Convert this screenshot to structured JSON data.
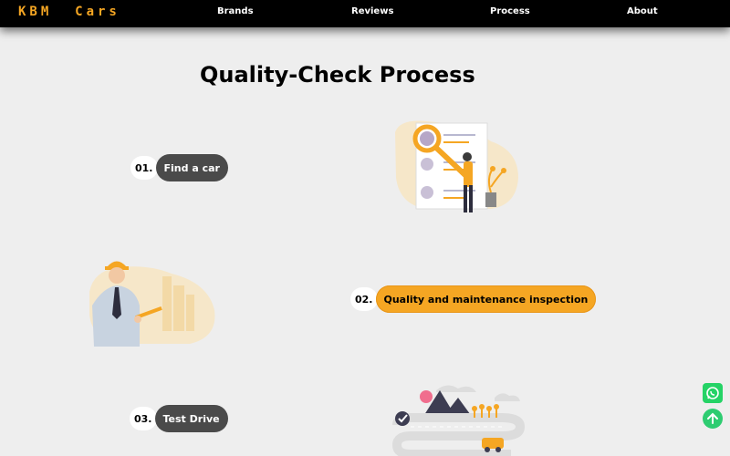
{
  "nav": {
    "brand": "KBM  Cars",
    "links": [
      "Brands",
      "Reviews",
      "Process",
      "About"
    ]
  },
  "title": "Quality-Check Process",
  "steps": [
    {
      "number": "01.",
      "label": "Find a car"
    },
    {
      "number": "02.",
      "label": "Quality and maintenance inspection"
    },
    {
      "number": "03.",
      "label": "Test Drive"
    }
  ],
  "colors": {
    "accent": "#f5a623",
    "nav_bg": "#000000",
    "page_bg": "#eeeeee",
    "pill_dark": "#4a4a4a",
    "whatsapp": "#25d366",
    "scroll_top": "#2ecc71"
  },
  "icons": {
    "whatsapp": "whatsapp-icon",
    "scroll_top": "arrow-up-icon"
  }
}
